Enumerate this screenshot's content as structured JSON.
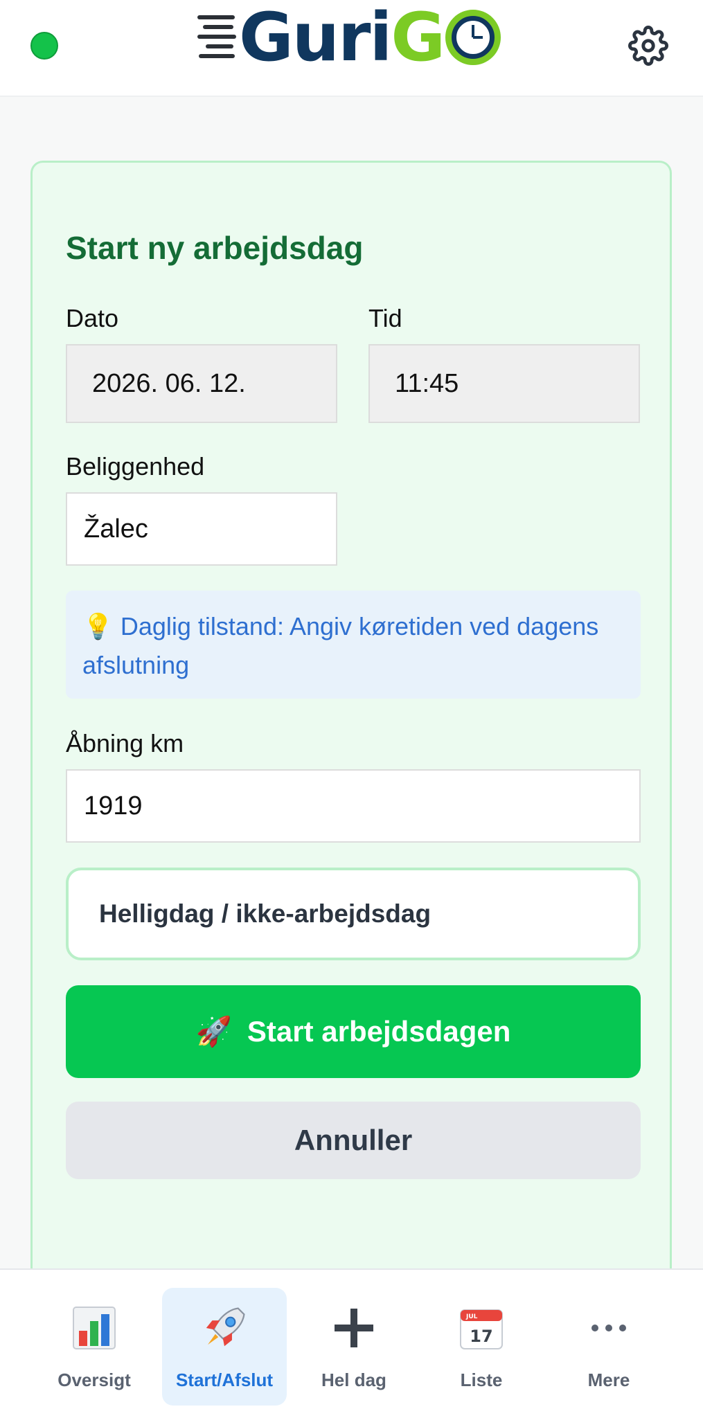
{
  "header": {
    "logo_text_dark": "Guri",
    "logo_text_green": "G",
    "status_color": "#14c24a",
    "settings_icon": "gear-icon"
  },
  "form": {
    "title": "Start ny arbejdsdag",
    "date_label": "Dato",
    "date_value": "2026. 06. 12.",
    "time_label": "Tid",
    "time_value": "11:45",
    "location_label": "Beliggenhed",
    "location_value": "Žalec",
    "info_icon": "💡",
    "info_text": "Daglig tilstand: Angiv køretiden ved dagens afslutning",
    "opening_km_label": "Åbning km",
    "opening_km_value": "1919",
    "holiday_label": "Helligdag / ikke-arbejdsdag",
    "start_icon": "🚀",
    "start_label": "Start arbejdsdagen",
    "cancel_label": "Annuller"
  },
  "nav": {
    "items": [
      {
        "label": "Oversigt",
        "icon": "bar-chart-icon"
      },
      {
        "label": "Start/Afslut",
        "icon": "rocket-icon",
        "active": true
      },
      {
        "label": "Hel dag",
        "icon": "plus-icon"
      },
      {
        "label": "Liste",
        "icon": "calendar-icon",
        "calendar_month": "JUL",
        "calendar_day": "17"
      },
      {
        "label": "Mere",
        "icon": "more-dots-icon"
      }
    ]
  },
  "colors": {
    "brand_green": "#06c752",
    "brand_navy": "#10375e",
    "title_green": "#146c36",
    "info_blue": "#2e6fd0",
    "active_blue": "#1f72d8"
  }
}
